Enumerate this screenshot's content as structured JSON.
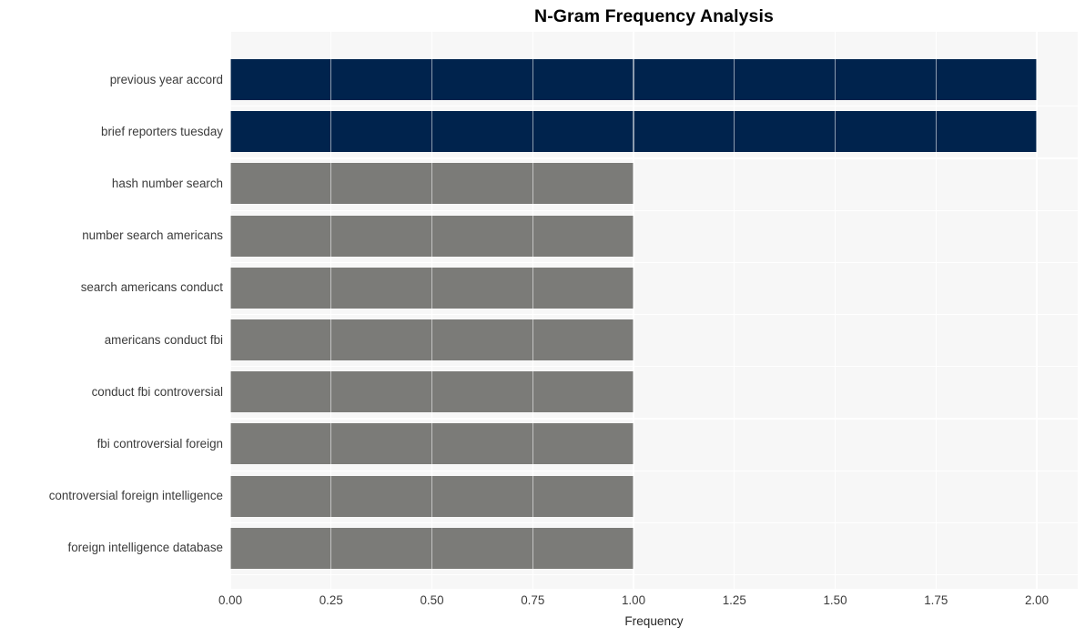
{
  "chart_data": {
    "type": "bar",
    "orientation": "horizontal",
    "title": "N-Gram Frequency Analysis",
    "xlabel": "Frequency",
    "ylabel": "",
    "xlim": [
      0.0,
      2.0
    ],
    "grid": true,
    "legend": "none",
    "categories": [
      "previous year accord",
      "brief reporters tuesday",
      "hash number search",
      "number search americans",
      "search americans conduct",
      "americans conduct fbi",
      "conduct fbi controversial",
      "fbi controversial foreign",
      "controversial foreign intelligence",
      "foreign intelligence database"
    ],
    "values": [
      2,
      2,
      1,
      1,
      1,
      1,
      1,
      1,
      1,
      1
    ],
    "bar_colors": [
      "#00234d",
      "#00234d",
      "#7b7b78",
      "#7b7b78",
      "#7b7b78",
      "#7b7b78",
      "#7b7b78",
      "#7b7b78",
      "#7b7b78",
      "#7b7b78"
    ],
    "xticks": [
      "0.00",
      "0.25",
      "0.50",
      "0.75",
      "1.00",
      "1.25",
      "1.50",
      "1.75",
      "2.00"
    ],
    "xtick_values": [
      0.0,
      0.25,
      0.5,
      0.75,
      1.0,
      1.25,
      1.5,
      1.75,
      2.0
    ],
    "colors": {
      "highlight": "#00234d",
      "default": "#7b7b78",
      "plot_background": "#f7f7f7",
      "figure_background": "#ffffff",
      "gridline": "#ffffff",
      "text": "#3b3b3b",
      "title_text": "#000000"
    }
  }
}
